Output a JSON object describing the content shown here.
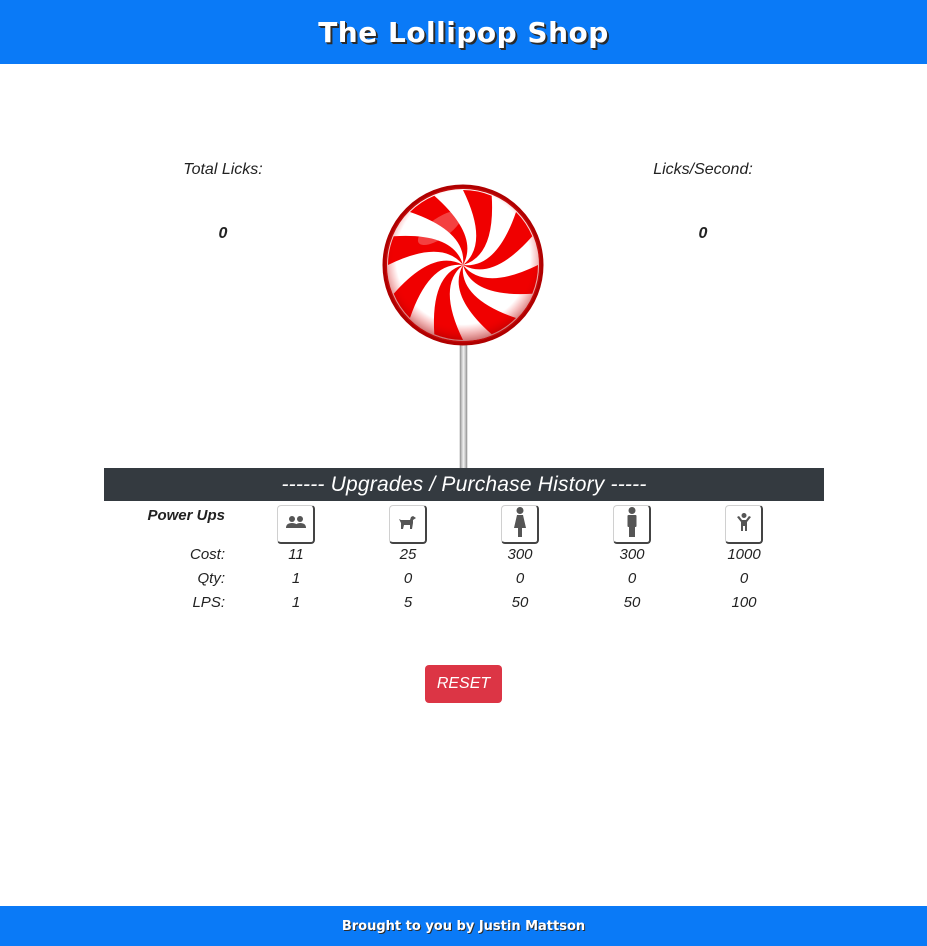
{
  "header": {
    "title": "The Lollipop Shop"
  },
  "stats": {
    "total": {
      "label": "Total Licks:",
      "value": "0"
    },
    "lps": {
      "label": "Licks/Second:",
      "value": "0"
    }
  },
  "section": {
    "title": "------ Upgrades / Purchase History -----"
  },
  "upgrades": {
    "powerups_label": "Power Ups",
    "row_labels": {
      "cost": "Cost:",
      "qty": "Qty:",
      "lps": "LPS:"
    },
    "items": [
      {
        "icon": "group-icon",
        "cost": "11",
        "qty": "1",
        "lps": "1"
      },
      {
        "icon": "dog-icon",
        "cost": "25",
        "qty": "0",
        "lps": "5"
      },
      {
        "icon": "woman-icon",
        "cost": "300",
        "qty": "0",
        "lps": "50"
      },
      {
        "icon": "man-icon",
        "cost": "300",
        "qty": "0",
        "lps": "50"
      },
      {
        "icon": "child-icon",
        "cost": "1000",
        "qty": "0",
        "lps": "100"
      }
    ]
  },
  "reset": {
    "label": "RESET"
  },
  "footer": {
    "text": "Brought to you by Justin Mattson"
  },
  "colors": {
    "brand": "#0a7af7",
    "section_bar": "#343a40",
    "reset": "#dc3545"
  }
}
